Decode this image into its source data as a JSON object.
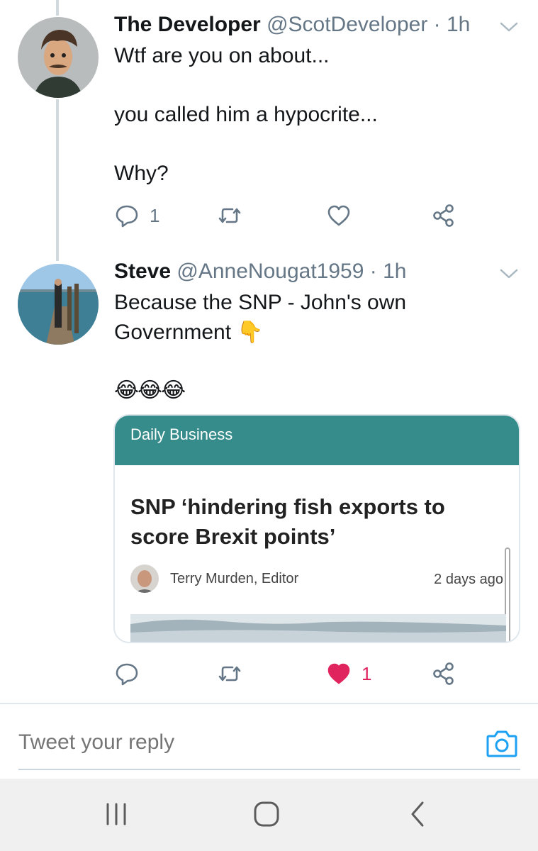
{
  "tweets": [
    {
      "name": "The Developer",
      "handle": "@ScotDeveloper",
      "separator": "·",
      "time": "1h",
      "lines": [
        "Wtf are you on about...",
        "you called him a hypocrite...",
        "Why?"
      ],
      "actions": {
        "replies": "1",
        "retweets": "",
        "likes": "",
        "liked": false
      }
    },
    {
      "name": "Steve",
      "handle": "@AnneNougat1959",
      "separator": "·",
      "time": "1h",
      "lines": [
        "Because the SNP - John's own",
        "Government 👇",
        "😂😂😂"
      ],
      "actions": {
        "replies": "",
        "retweets": "",
        "likes": "1",
        "liked": true
      }
    }
  ],
  "card": {
    "source": "Daily Business",
    "headline": "SNP ‘hindering fish exports to score Brexit points’",
    "author": "Terry Murden, Editor",
    "date": "2 days ago",
    "accent_color": "#358c8a"
  },
  "reply": {
    "placeholder": "Tweet your reply"
  },
  "icons": {
    "reply": "reply-icon",
    "retweet": "retweet-icon",
    "like": "heart-icon",
    "share": "share-icon",
    "camera": "camera-icon"
  },
  "colors": {
    "brand": "#1da1f2",
    "like": "#e0245e",
    "muted": "#657786"
  }
}
